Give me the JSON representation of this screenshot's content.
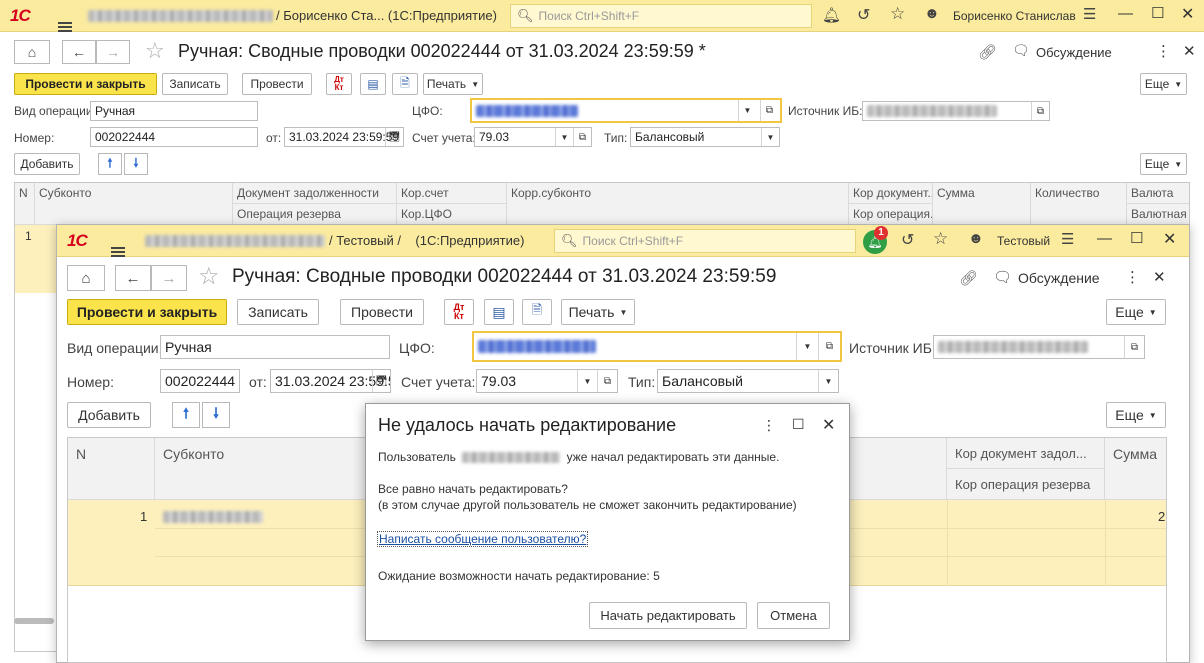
{
  "bg": {
    "app_suffix": "/ Борисенко Ста...  (1С:Предприятие)",
    "search_placeholder": "Поиск Ctrl+Shift+F",
    "user": "Борисенко Станислав",
    "doc_title": "Ручная: Сводные проводки 002022444 от 31.03.2024 23:59:59 *",
    "discussion": "Обсуждение",
    "toolbar": {
      "post_close": "Провести и закрыть",
      "save": "Записать",
      "post": "Провести",
      "print": "Печать",
      "more": "Еще"
    },
    "labels": {
      "op_type": "Вид операции:",
      "cfo": "ЦФО:",
      "source": "Источник ИБ:",
      "number": "Номер:",
      "from": "от:",
      "account": "Счет учета:",
      "type": "Тип:"
    },
    "values": {
      "op_type": "Ручная",
      "number": "002022444",
      "date": "31.03.2024 23:59:59",
      "account": "79.03",
      "type": "Балансовый"
    },
    "add": "Добавить",
    "table": {
      "headers": [
        "N",
        "Субконто",
        "Документ задолженности",
        "Кор.счет",
        "Корр.субконто",
        "Кор документ...",
        "Сумма",
        "Количество",
        "Валюта"
      ],
      "sub_headers": [
        "Операция резерва",
        "Кор.ЦФО",
        "Кор операция...",
        "Валютная с..."
      ],
      "row_n": "1"
    }
  },
  "fg": {
    "app_suffix": "/ Тестовый /    (1С:Предприятие)",
    "search_placeholder": "Поиск Ctrl+Shift+F",
    "notification_count": "1",
    "user": "Тестовый",
    "doc_title": "Ручная: Сводные проводки 002022444 от 31.03.2024 23:59:59",
    "discussion": "Обсуждение",
    "toolbar": {
      "post_close": "Провести и закрыть",
      "save": "Записать",
      "post": "Провести",
      "print": "Печать",
      "more": "Еще"
    },
    "labels": {
      "op_type": "Вид операции:",
      "cfo": "ЦФО:",
      "source": "Источник ИБ:",
      "number": "Номер:",
      "from": "от:",
      "account": "Счет учета:",
      "type": "Тип:"
    },
    "values": {
      "op_type": "Ручная",
      "number": "002022444",
      "date": "31.03.2024 23:59:59",
      "account": "79.03",
      "type": "Балансовый"
    },
    "add": "Добавить",
    "table": {
      "headers": [
        "N",
        "Субконто",
        "Кор документ задол...",
        "Сумма"
      ],
      "sub_headers": [
        "Кор операция резерва"
      ],
      "row_n": "1",
      "row_sum": "2"
    }
  },
  "dialog": {
    "title": "Не удалось начать редактирование",
    "user_prefix": "Пользователь",
    "user_suffix": "уже начал редактировать эти данные.",
    "question": "Все равно начать редактировать?",
    "note": "(в этом случае другой пользователь не сможет закончить редактирование)",
    "link": "Написать сообщение пользователю?",
    "waiting": "Ожидание возможности начать редактирование:",
    "waiting_value": "5",
    "start_button": "Начать редактировать",
    "cancel_button": "Отмена"
  },
  "colors": {
    "titlebar": "#fbeb9f",
    "accent_button": "#fbe44b",
    "focus": "#f2c640",
    "row_highlight": "#fdf0bd",
    "link": "#1a4fa0"
  }
}
